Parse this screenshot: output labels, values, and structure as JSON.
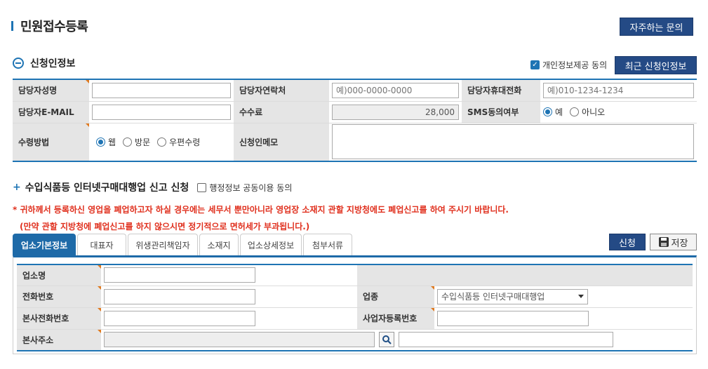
{
  "page": {
    "title": "민원접수등록",
    "faq_label": "자주하는 문의"
  },
  "applicant": {
    "section_title": "신청인정보",
    "privacy_consent": "개인정보제공 동의",
    "recent_button": "최근 신청인정보",
    "labels": {
      "name": "담당자성명",
      "contact": "담당자연락처",
      "mobile": "담당자휴대전화",
      "email": "담당자E-MAIL",
      "fee": "수수료",
      "sms": "SMS동의여부",
      "receive": "수령방법",
      "memo": "신청인메모"
    },
    "placeholders": {
      "contact": "예)000-0000-0000",
      "mobile": "예)010-1234-1234"
    },
    "fee_value": "28,000",
    "sms_options": [
      "예",
      "아니오"
    ],
    "receive_options": [
      "웹",
      "방문",
      "우편수령"
    ]
  },
  "report": {
    "title": "수입식품등 인터넷구매대행업 신고 신청",
    "admin_consent": "행정정보 공동이용 동의",
    "notice1": "* 귀하께서 등록하신 영업을 폐업하고자 하실 경우에는 세무서 뿐만아니라 영업장 소재지 관할 지방청에도 폐업신고를 하여 주시기 바랍니다.",
    "notice2": "(만약 관할 지방청에 폐업신고를 하지 않으시면 정기적으로 면허세가 부과됩니다.)"
  },
  "tabs": [
    "업소기본정보",
    "대표자",
    "위생관리책임자",
    "소재지",
    "업소상세정보",
    "첨부서류"
  ],
  "actions": {
    "apply": "신청",
    "save": "저장"
  },
  "business": {
    "labels": {
      "name": "업소명",
      "phone": "전화번호",
      "type": "업종",
      "hq_phone": "본사전화번호",
      "reg_no": "사업자등록번호",
      "hq_address": "본사주소"
    },
    "type_value": "수입식품등 인터넷구매대행업"
  },
  "colors": {
    "accent": "#1e74b4",
    "navy": "#244a85",
    "notice": "#e0301e",
    "required": "#e07a1f"
  }
}
